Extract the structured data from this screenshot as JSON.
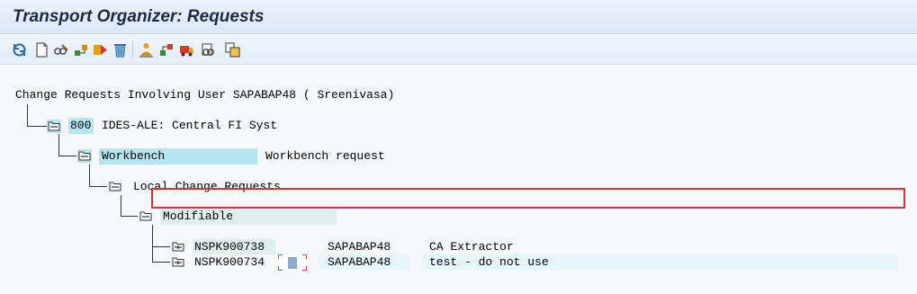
{
  "window": {
    "title": "Transport Organizer: Requests"
  },
  "toolbar": {
    "buttons": [
      {
        "icon": "refresh-icon"
      },
      {
        "icon": "create-icon"
      },
      {
        "icon": "display-change-icon"
      },
      {
        "icon": "release-icon"
      },
      {
        "icon": "transport-request-icon"
      },
      {
        "icon": "delete-icon"
      },
      {
        "icon": "add-user-icon"
      },
      {
        "icon": "assign-icon"
      },
      {
        "icon": "truck-icon"
      },
      {
        "icon": "display-object-icon"
      },
      {
        "icon": "copy-icon"
      }
    ]
  },
  "tree": {
    "header": "Change Requests Involving User SAPABAP48 ( Sreenivasa)",
    "client": {
      "number": "800",
      "description": "IDES-ALE: Central FI Syst"
    },
    "workbench": {
      "label": "Workbench",
      "description": "Workbench request"
    },
    "local": {
      "label": "Local Change Requests"
    },
    "modifiable": {
      "label": "Modifiable"
    },
    "requests": [
      {
        "id": "NSPK900738",
        "owner": "SAPABAP48",
        "text": "CA Extractor"
      },
      {
        "id": "NSPK900734",
        "owner": "SAPABAP48",
        "text": "test - do not use",
        "selected": true
      }
    ]
  },
  "colors": {
    "highlight_cyan": "#b4e6f2",
    "highlight_mint": "#dff0ec",
    "selection_border": "#d63333"
  }
}
